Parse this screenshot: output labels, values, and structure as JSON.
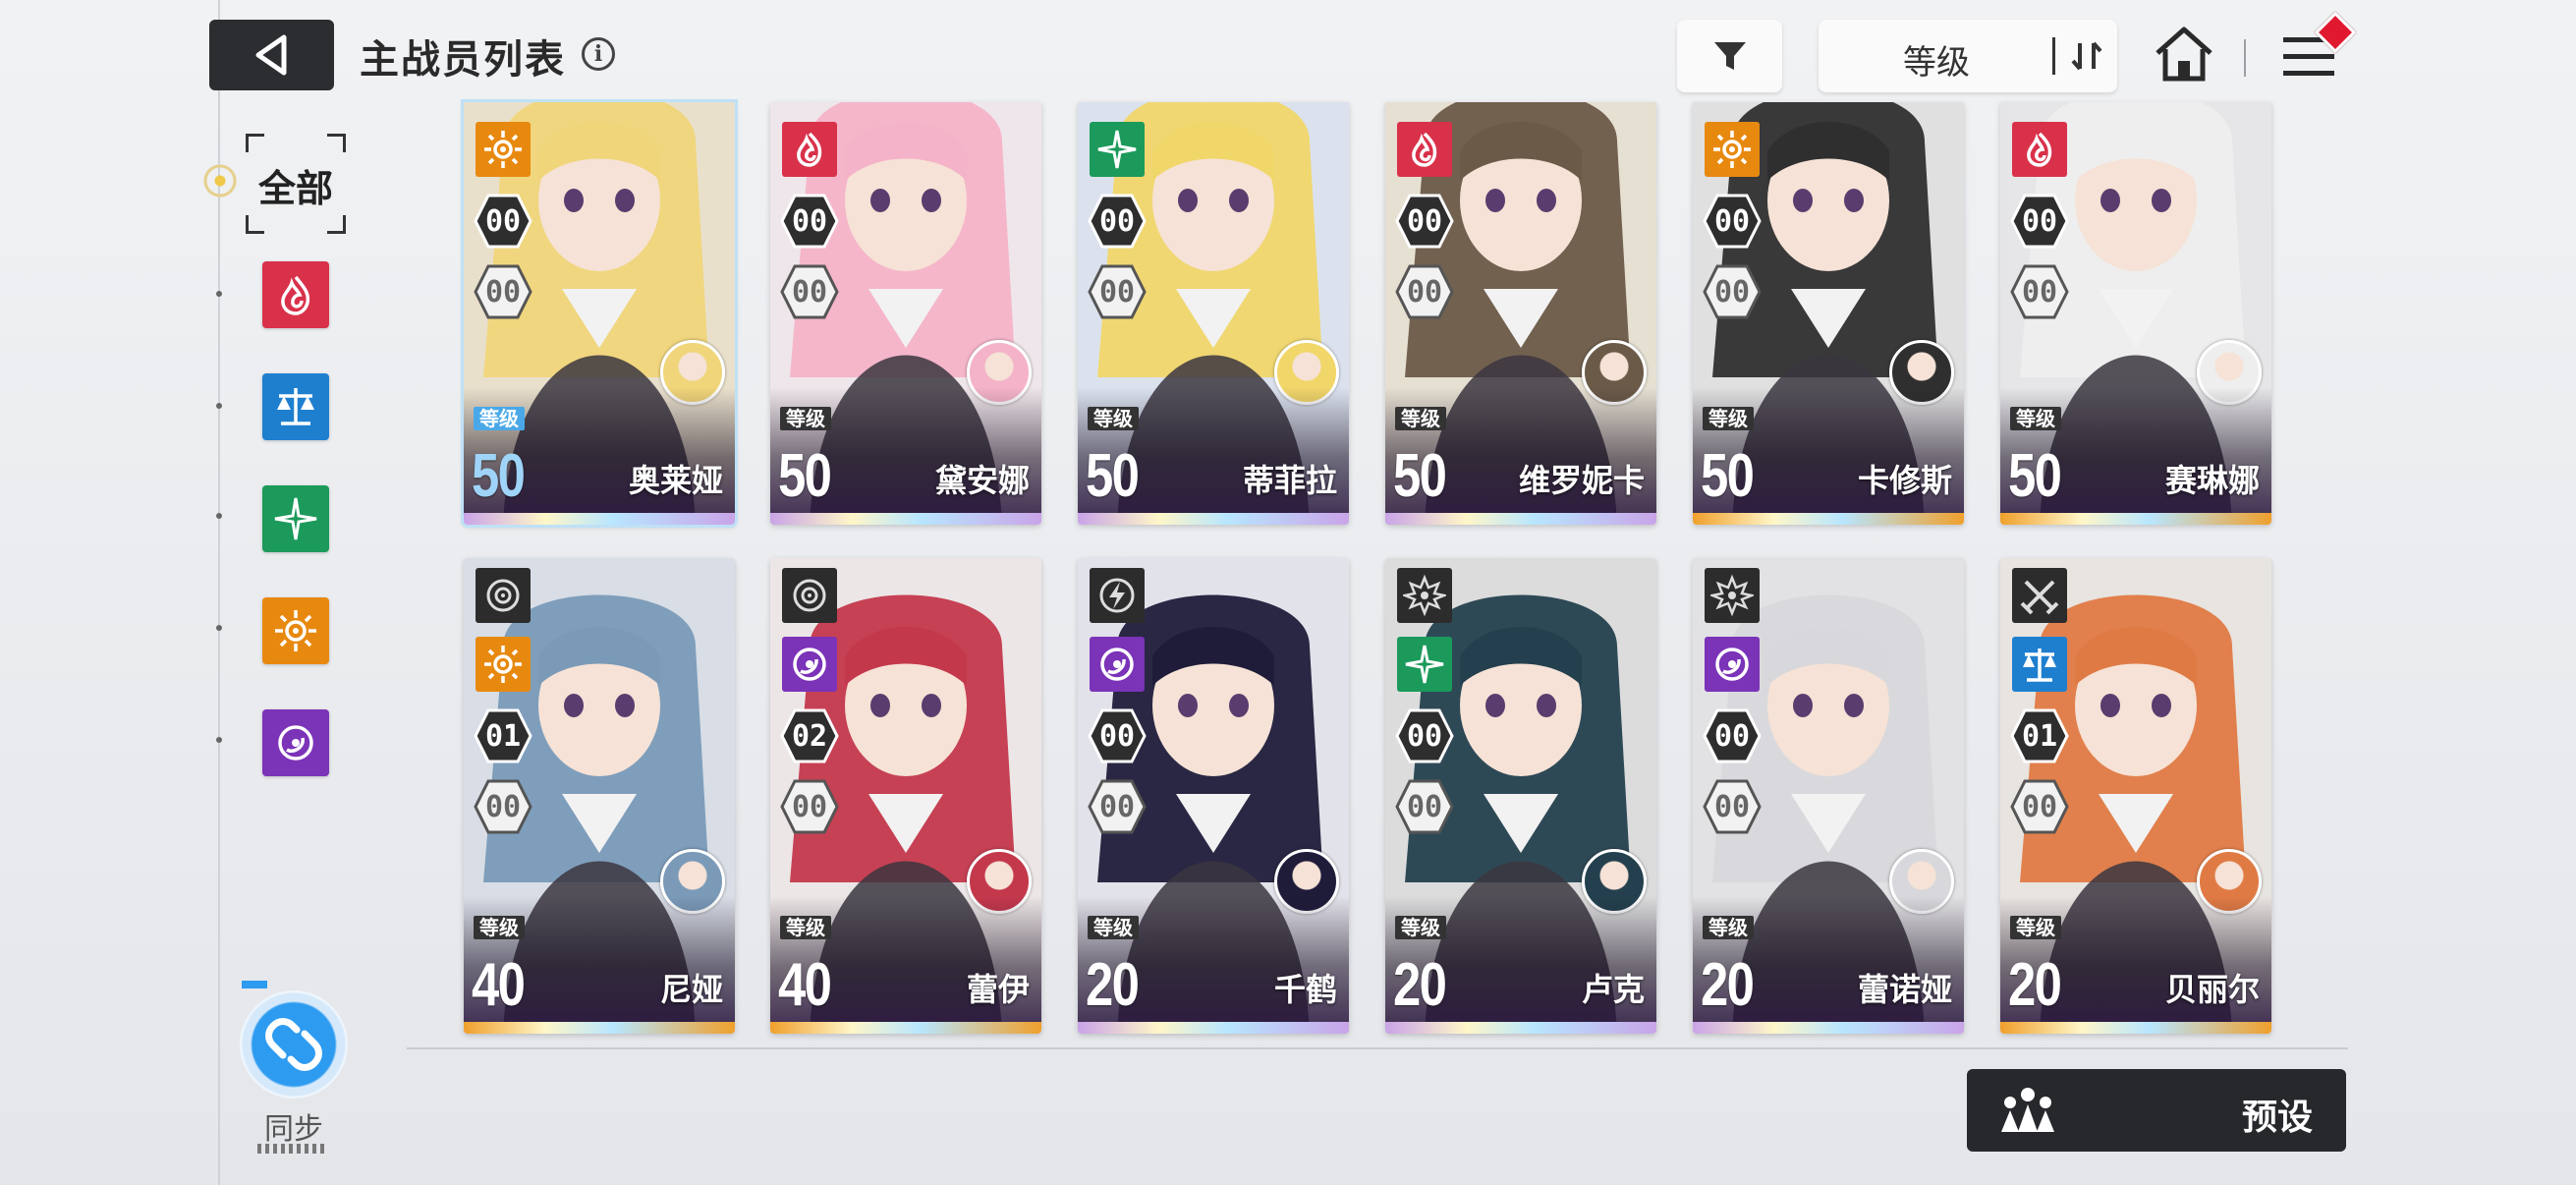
{
  "header": {
    "title": "主战员列表",
    "info_icon": "i",
    "sort_label": "等级"
  },
  "filters": {
    "all_label": "全部",
    "elements": [
      {
        "name": "burn",
        "color": "#d9314a"
      },
      {
        "name": "order",
        "color": "#1f7fcf"
      },
      {
        "name": "wind",
        "color": "#1c9a5b"
      },
      {
        "name": "solar",
        "color": "#e8890f"
      },
      {
        "name": "void",
        "color": "#7b33b8"
      }
    ]
  },
  "sync": {
    "label": "同步"
  },
  "preset": {
    "label": "预设"
  },
  "level_tag": "等级",
  "cards": [
    {
      "name": "奥莱娅",
      "level": "50",
      "element": "solar",
      "el_color": "#e8890f",
      "class_icon": "",
      "skill": "00",
      "rank": "00",
      "hair": "#f0d57a",
      "bg": "#e9e0cc",
      "rarity": "#c9a4e8",
      "selected": true
    },
    {
      "name": "黛安娜",
      "level": "50",
      "element": "burn",
      "el_color": "#d9314a",
      "class_icon": "",
      "skill": "00",
      "rank": "00",
      "hair": "#f4b3c8",
      "bg": "#eee6ea",
      "rarity": "#c9a4e8",
      "selected": false
    },
    {
      "name": "蒂菲拉",
      "level": "50",
      "element": "wind",
      "el_color": "#1c9a5b",
      "class_icon": "",
      "skill": "00",
      "rank": "00",
      "hair": "#f1d66a",
      "bg": "#dbe2ee",
      "rarity": "#c9a4e8",
      "selected": false
    },
    {
      "name": "维罗妮卡",
      "level": "50",
      "element": "burn",
      "el_color": "#d9314a",
      "class_icon": "",
      "skill": "00",
      "rank": "00",
      "hair": "#6b5a48",
      "bg": "#e6e0d2",
      "rarity": "#c9a4e8",
      "selected": false
    },
    {
      "name": "卡修斯",
      "level": "50",
      "element": "solar",
      "el_color": "#e8890f",
      "class_icon": "",
      "skill": "00",
      "rank": "00",
      "hair": "#2f2f2f",
      "bg": "#e0e0e0",
      "rarity": "#f0a02c",
      "selected": false
    },
    {
      "name": "赛琳娜",
      "level": "50",
      "element": "burn",
      "el_color": "#d9314a",
      "class_icon": "",
      "skill": "00",
      "rank": "00",
      "hair": "#eeeeee",
      "bg": "#e6e6e8",
      "rarity": "#f0a02c",
      "selected": false
    },
    {
      "name": "尼娅",
      "level": "40",
      "element": "solar",
      "el_color": "#e8890f",
      "class_icon": "target",
      "skill": "01",
      "rank": "00",
      "hair": "#7a9ab8",
      "bg": "#d8dde6",
      "rarity": "#f0a02c",
      "selected": false
    },
    {
      "name": "蕾伊",
      "level": "40",
      "element": "void",
      "el_color": "#7b33b8",
      "class_icon": "target",
      "skill": "02",
      "rank": "00",
      "hair": "#c4384c",
      "bg": "#ece6e6",
      "rarity": "#f0a02c",
      "selected": false
    },
    {
      "name": "千鹤",
      "level": "20",
      "element": "void",
      "el_color": "#7b33b8",
      "class_icon": "lightning",
      "skill": "00",
      "rank": "00",
      "hair": "#1f1c3a",
      "bg": "#e2e2ea",
      "rarity": "#c9a4e8",
      "selected": false
    },
    {
      "name": "卢克",
      "level": "20",
      "element": "wind",
      "el_color": "#1c9a5b",
      "class_icon": "gear",
      "skill": "00",
      "rank": "00",
      "hair": "#24404e",
      "bg": "#dcdcdc",
      "rarity": "#c9a4e8",
      "selected": false
    },
    {
      "name": "蕾诺娅",
      "level": "20",
      "element": "void",
      "el_color": "#7b33b8",
      "class_icon": "gear",
      "skill": "00",
      "rank": "00",
      "hair": "#d8d8dc",
      "bg": "#e2e2e4",
      "rarity": "#c9a4e8",
      "selected": false
    },
    {
      "name": "贝丽尔",
      "level": "20",
      "element": "order",
      "el_color": "#1f7fcf",
      "class_icon": "swords",
      "skill": "01",
      "rank": "00",
      "hair": "#e07a44",
      "bg": "#e8e4e0",
      "rarity": "#f0a02c",
      "selected": false
    }
  ]
}
